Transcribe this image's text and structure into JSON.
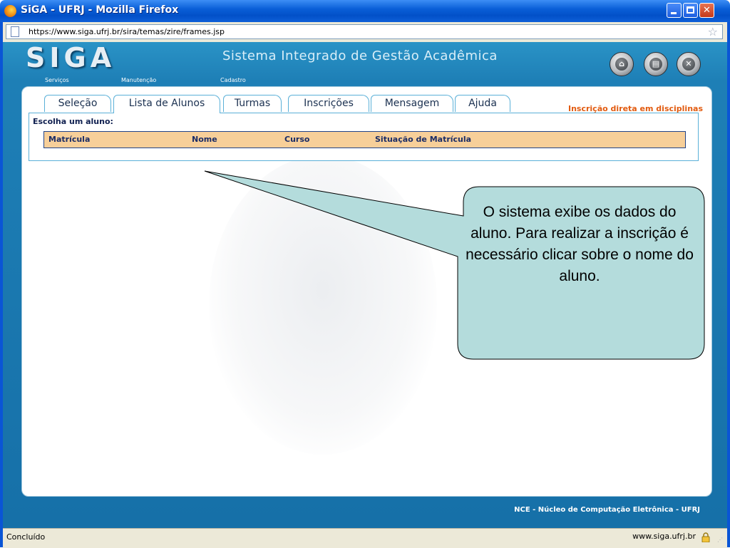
{
  "window": {
    "title": "SiGA - UFRJ - Mozilla Firefox",
    "url": "https://www.siga.ufrj.br/sira/temas/zire/frames.jsp"
  },
  "app": {
    "logo": "SIGA",
    "menu": [
      "Serviços",
      "Manutenção",
      "Cadastro"
    ],
    "system_title": "Sistema Integrado de Gestão Acadêmica",
    "header_icons": [
      "home-icon",
      "print-icon",
      "close-icon"
    ],
    "tabs": [
      {
        "label": "Seleção"
      },
      {
        "label": "Lista de Alunos",
        "active": true
      },
      {
        "label": "Turmas"
      },
      {
        "label": "Inscrições"
      },
      {
        "label": "Mensagem"
      },
      {
        "label": "Ajuda"
      }
    ],
    "hint": "Inscrição direta em disciplinas",
    "choose_label": "Escolha um aluno:",
    "table_headers": [
      "Matrícula",
      "Nome",
      "Curso",
      "Situação de Matrícula"
    ],
    "footer": "NCE - Núcleo de Computação Eletrônica - UFRJ"
  },
  "status": {
    "text": "Concluído",
    "host": "www.siga.ufrj.br"
  },
  "callout": {
    "text": "O sistema exibe os dados do aluno. Para realizar a inscrição é necessário clicar sobre o nome do aluno."
  },
  "colors": {
    "accent": "#1e7fb6",
    "table_header": "#f7cf99",
    "hint": "#e25b10",
    "callout_fill": "#b4dcdc"
  }
}
